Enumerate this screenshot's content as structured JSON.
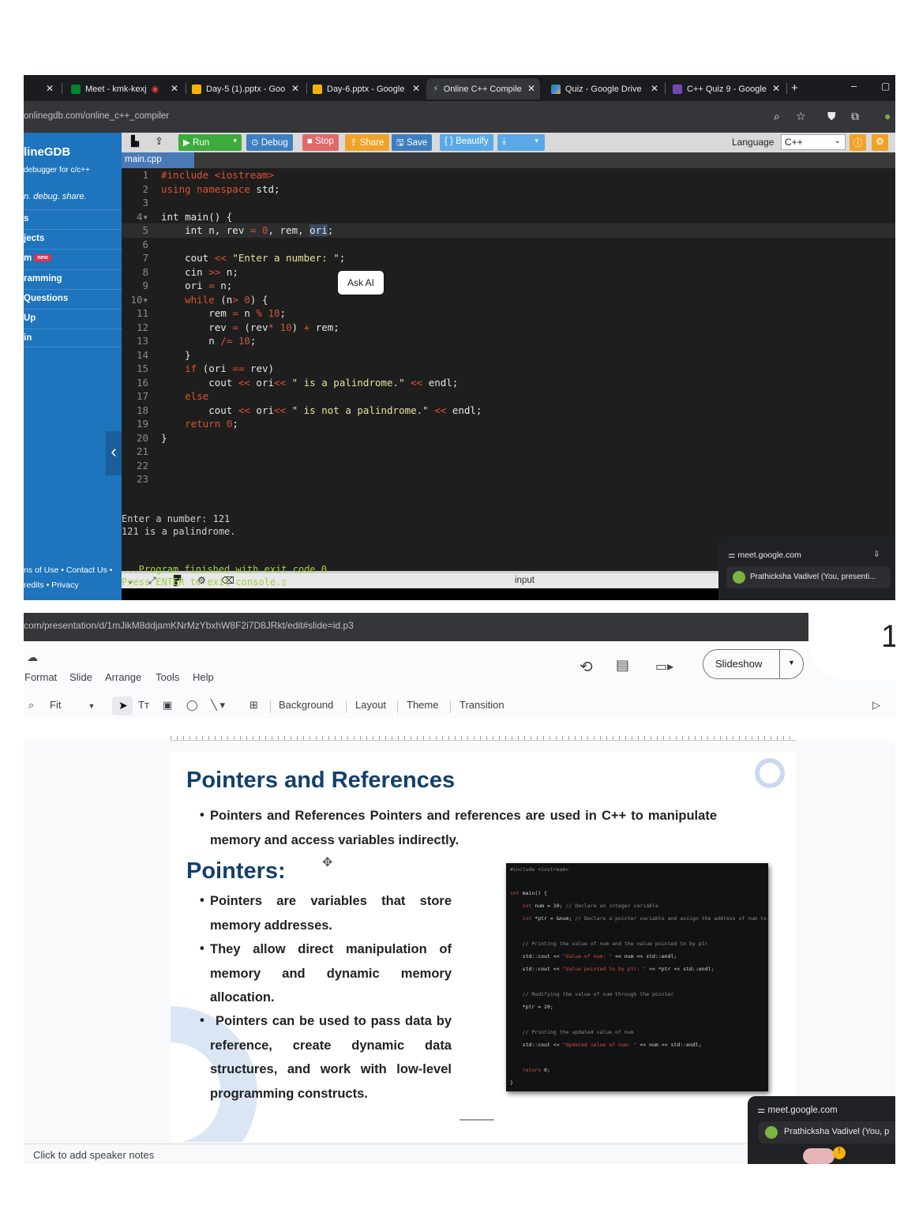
{
  "shot1": {
    "tabs": [
      {
        "label": "",
        "active": false
      },
      {
        "label": "Meet - kmk-kexj",
        "active": false
      },
      {
        "label": "Day-5 (1).pptx - Goo",
        "active": false
      },
      {
        "label": "Day-6.pptx - Google",
        "active": false
      },
      {
        "label": "Online C++ Compile",
        "active": true
      },
      {
        "label": "Quiz - Google Drive",
        "active": false
      },
      {
        "label": "C++ Quiz 9 - Google",
        "active": false
      }
    ],
    "new_tab_label": "+",
    "url": "onlinegdb.com/online_c++_compiler",
    "sidebar": {
      "logo": "lineGDB",
      "subtitle": "debugger for c/c++",
      "tagline": "n. debug. share.",
      "items": [
        {
          "label": "s"
        },
        {
          "label": "jects"
        },
        {
          "label": "m",
          "badge": "new"
        },
        {
          "label": "ramming"
        },
        {
          "label": "Questions"
        },
        {
          "label": "Up"
        },
        {
          "label": "in"
        }
      ],
      "footer1": "ns of Use • Contact Us •",
      "footer2": "redits • Privacy",
      "collapse_glyph": "‹"
    },
    "toolbar": {
      "run": "▶ Run",
      "debug": "⊙ Debug",
      "stop": "■ Stop",
      "share": "⇪ Share",
      "save": "🖫 Save",
      "beautify": "{ } Beautify",
      "download": "⤓",
      "language_label": "Language",
      "language_value": "C++"
    },
    "file_tab": "main.cpp",
    "ask_ai": "Ask AI",
    "code": [
      {
        "n": "1",
        "t": "#include <iostream>"
      },
      {
        "n": "2",
        "t": "using namespace std;"
      },
      {
        "n": "3",
        "t": ""
      },
      {
        "n": "4",
        "t": "int main() {"
      },
      {
        "n": "5",
        "t": "    int n, rev = 0, rem, ori;"
      },
      {
        "n": "6",
        "t": ""
      },
      {
        "n": "7",
        "t": "    cout << \"Enter a number: \";"
      },
      {
        "n": "8",
        "t": "    cin >> n;"
      },
      {
        "n": "9",
        "t": "    ori = n;"
      },
      {
        "n": "10",
        "t": "    while (n> 0) {"
      },
      {
        "n": "11",
        "t": "        rem = n % 10;"
      },
      {
        "n": "12",
        "t": "        rev = (rev* 10) + rem;"
      },
      {
        "n": "13",
        "t": "        n /= 10;"
      },
      {
        "n": "14",
        "t": "    }"
      },
      {
        "n": "15",
        "t": "    if (ori == rev)"
      },
      {
        "n": "16",
        "t": "        cout << ori<< \" is a palindrome.\" << endl;"
      },
      {
        "n": "17",
        "t": "    else"
      },
      {
        "n": "18",
        "t": "        cout << ori<< \" is not a palindrome.\" << endl;"
      },
      {
        "n": "19",
        "t": "    return 0;"
      },
      {
        "n": "20",
        "t": "}"
      },
      {
        "n": "21",
        "t": ""
      },
      {
        "n": "22",
        "t": ""
      },
      {
        "n": "23",
        "t": ""
      }
    ],
    "console_label": "input",
    "console_lines": [
      "Enter a number: 121",
      "121 is a palindrome.",
      "",
      "",
      "...Program finished with exit code 0",
      "Press ENTER to exit console.▯"
    ],
    "meet": {
      "site": "meet.google.com",
      "presenter": "Prathicksha Vadivel (You, presenti..."
    }
  },
  "shot2": {
    "url": "com/presentation/d/1mJikM8ddjamKNrMzYbxhW8F2i7D8JRkt/edit#slide=id.p3",
    "menu": [
      "Format",
      "Slide",
      "Arrange",
      "Tools",
      "Help"
    ],
    "slideshow_label": "Slideshow",
    "zoom_label": "Fit",
    "tools": [
      "Background",
      "Layout",
      "Theme",
      "Transition"
    ],
    "slide": {
      "title1": "Pointers and References",
      "intro": "Pointers and References Pointers and references are used in C++ to manipulate memory and access variables indirectly.",
      "title2": "Pointers:",
      "bullets": [
        "Pointers are variables that store memory addresses.",
        "They allow direct manipulation of memory and dynamic memory allocation.",
        "Pointers can be used to pass data by reference, create dynamic data structures, and work with low-level programming constructs."
      ]
    },
    "notes_placeholder": "Click to add speaker notes",
    "corner_number": "1",
    "meet": {
      "site": "meet.google.com",
      "presenter": "Prathicksha Vadivel (You, p"
    }
  }
}
